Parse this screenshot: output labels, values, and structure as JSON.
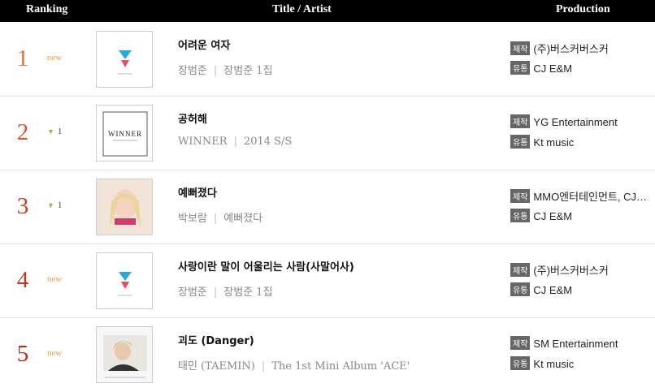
{
  "header": {
    "ranking": "Ranking",
    "title_artist": "Title / Artist",
    "production": "Production"
  },
  "colors": {
    "header_bg": "#000000",
    "rank_colors": [
      "#e86a3e",
      "#e24e2e",
      "#d43c22",
      "#c4341c",
      "#b82d19"
    ],
    "new_badge": "#e8a23a",
    "down_arrow": "#8cbf3f",
    "tag_bg": "#666666"
  },
  "rows": [
    {
      "rank": "1",
      "change": "new",
      "change_type": "new",
      "cover_icon": "triangle-logo-icon",
      "song": "어려운 여자",
      "artist": "장범준",
      "album": "장범준 1집",
      "tag_producer": "제작",
      "producer": "(주)버스커버스커",
      "tag_distributor": "유통",
      "distributor": "CJ E&M"
    },
    {
      "rank": "2",
      "change": "1",
      "change_type": "down",
      "cover_icon": "winner-album-cover",
      "song": "공허해",
      "artist": "WINNER",
      "album": "2014 S/S",
      "tag_producer": "제작",
      "producer": "YG Entertainment",
      "tag_distributor": "유통",
      "distributor": "Kt music"
    },
    {
      "rank": "3",
      "change": "1",
      "change_type": "down",
      "cover_icon": "portrait-album-cover",
      "song": "예뻐졌다",
      "artist": "박보람",
      "album": "예뻐졌다",
      "tag_producer": "제작",
      "producer": "MMO엔터테인먼트, CJ…",
      "tag_distributor": "유통",
      "distributor": "CJ E&M"
    },
    {
      "rank": "4",
      "change": "new",
      "change_type": "new",
      "cover_icon": "triangle-logo-icon",
      "song": "사랑이란 말이 어울리는 사람(사말어사)",
      "artist": "장범준",
      "album": "장범준 1집",
      "tag_producer": "제작",
      "producer": "(주)버스커버스커",
      "tag_distributor": "유통",
      "distributor": "CJ E&M"
    },
    {
      "rank": "5",
      "change": "new",
      "change_type": "new",
      "cover_icon": "photo-album-cover",
      "song": "괴도 (Danger)",
      "artist": "태민 (TAEMIN)",
      "album": "The 1st Mini Album 'ACE'",
      "tag_producer": "제작",
      "producer": "SM Entertainment",
      "tag_distributor": "유통",
      "distributor": "Kt music"
    }
  ]
}
